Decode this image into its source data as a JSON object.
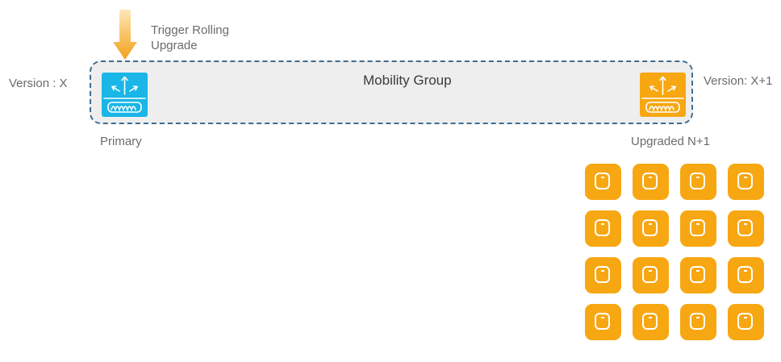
{
  "trigger": {
    "line1": "Trigger Rolling",
    "line2": "Upgrade",
    "arrow_color": "#f2a91a"
  },
  "version_left": "Version : X",
  "version_right": "Version: X+1",
  "mobility_group": {
    "title": "Mobility Group",
    "border_color": "#3f6c8f",
    "fill_color": "#eeeeee"
  },
  "primary_controller": {
    "caption": "Primary",
    "color": "#19b6e7",
    "icon": "wireless-controller-icon"
  },
  "upgraded_controller": {
    "caption": "Upgraded N+1",
    "color": "#f7a712",
    "icon": "wireless-controller-icon"
  },
  "access_points": {
    "rows": 4,
    "columns": 4,
    "color": "#f7a712",
    "icon": "access-point-icon"
  }
}
